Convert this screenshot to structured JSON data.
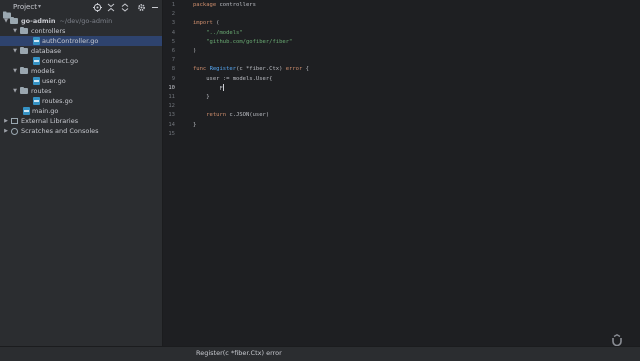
{
  "project_panel": {
    "title": "Project",
    "tree": [
      {
        "label": "go-admin",
        "path": "~/dev/go-admin",
        "type": "folder",
        "depth": 0,
        "expanded": true
      },
      {
        "label": "controllers",
        "type": "folder",
        "depth": 1,
        "expanded": true
      },
      {
        "label": "authController.go",
        "type": "go-file",
        "depth": 2,
        "selected": true
      },
      {
        "label": "database",
        "type": "folder",
        "depth": 1,
        "expanded": true
      },
      {
        "label": "connect.go",
        "type": "go-file",
        "depth": 2
      },
      {
        "label": "models",
        "type": "folder",
        "depth": 1,
        "expanded": true
      },
      {
        "label": "user.go",
        "type": "go-file",
        "depth": 2
      },
      {
        "label": "routes",
        "type": "folder",
        "depth": 1,
        "expanded": true
      },
      {
        "label": "routes.go",
        "type": "go-file",
        "depth": 2
      },
      {
        "label": "main.go",
        "type": "go-file",
        "depth": 1
      },
      {
        "label": "External Libraries",
        "type": "libraries",
        "depth": 0
      },
      {
        "label": "Scratches and Consoles",
        "type": "scratches",
        "depth": 0
      }
    ]
  },
  "editor": {
    "current_line": 10,
    "line_numbers": [
      "1",
      "2",
      "3",
      "4",
      "5",
      "6",
      "7",
      "8",
      "9",
      "10",
      "11",
      "12",
      "13",
      "14",
      "15"
    ],
    "lines": [
      "package controllers",
      "",
      "import (",
      "    \"../models\"",
      "    \"github.com/gofiber/fiber\"",
      ")",
      "",
      "func Register(c *fiber.Ctx) error {",
      "    user := models.User{",
      "        F",
      "    }",
      "",
      "    return c.JSON(user)",
      "}",
      ""
    ]
  },
  "status_bar": {
    "text": "Register(c *fiber.Ctx) error"
  },
  "icons": {
    "project_header": "folder-icon",
    "header_buttons": [
      "locate-icon",
      "collapse-all-icon",
      "expand-all-icon",
      "gear-icon",
      "hide-icon"
    ],
    "watermark": "udemy-logo-icon"
  },
  "colors": {
    "background": "#1e1f22",
    "panel": "#2b2d30",
    "selection": "#2e436e",
    "keyword": "#cf8e6d",
    "string": "#6aab73",
    "function": "#56a8f5"
  }
}
